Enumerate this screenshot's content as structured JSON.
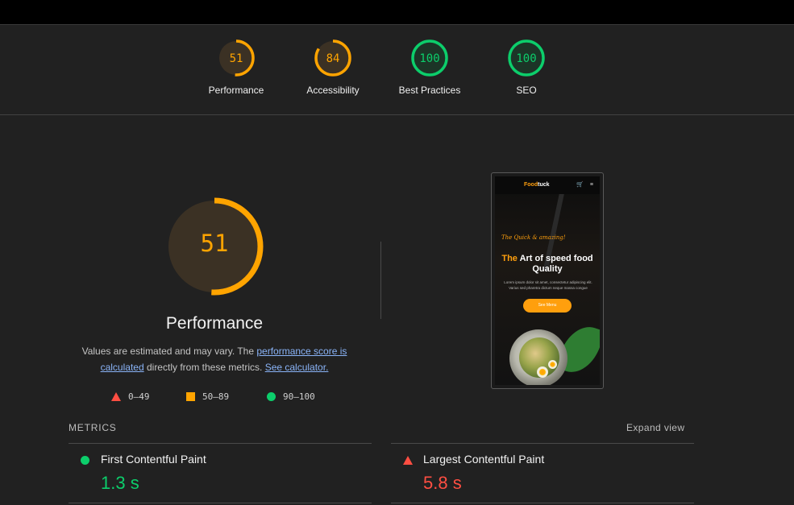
{
  "categories": [
    {
      "label": "Performance",
      "score": 51,
      "color": "#ffa400"
    },
    {
      "label": "Accessibility",
      "score": 84,
      "color": "#ffa400"
    },
    {
      "label": "Best Practices",
      "score": 100,
      "color": "#0cce6b"
    },
    {
      "label": "SEO",
      "score": 100,
      "color": "#0cce6b"
    }
  ],
  "main": {
    "score": 51,
    "title": "Performance",
    "desc_prefix": "Values are estimated and may vary. The ",
    "link_score": "performance score is calculated",
    "desc_mid": " directly from these metrics. ",
    "link_calc": "See calculator."
  },
  "legend": {
    "red": "0–49",
    "orange": "50–89",
    "green": "90–100"
  },
  "preview": {
    "brand_a": "Food",
    "brand_b": "tuck",
    "icons": "🛒 ≡",
    "script": "The Quick & amazing!",
    "heading_accent": "The",
    "heading_rest": "Art of speed food Quality",
    "body": "Lorem ipsum dolor sit amet, consectetur adipiscing elit. Varius sed pharetra dictum neque massa congue",
    "button": "See Menu"
  },
  "metrics": {
    "label": "METRICS",
    "expand": "Expand view",
    "items": [
      {
        "name": "First Contentful Paint",
        "value": "1.3 s",
        "status": "good",
        "color": "#0cce6b"
      },
      {
        "name": "Largest Contentful Paint",
        "value": "5.8 s",
        "status": "poor",
        "color": "#ff4e42"
      }
    ]
  },
  "colors": {
    "good": "#0cce6b",
    "average": "#ffa400",
    "poor": "#ff4e42"
  }
}
